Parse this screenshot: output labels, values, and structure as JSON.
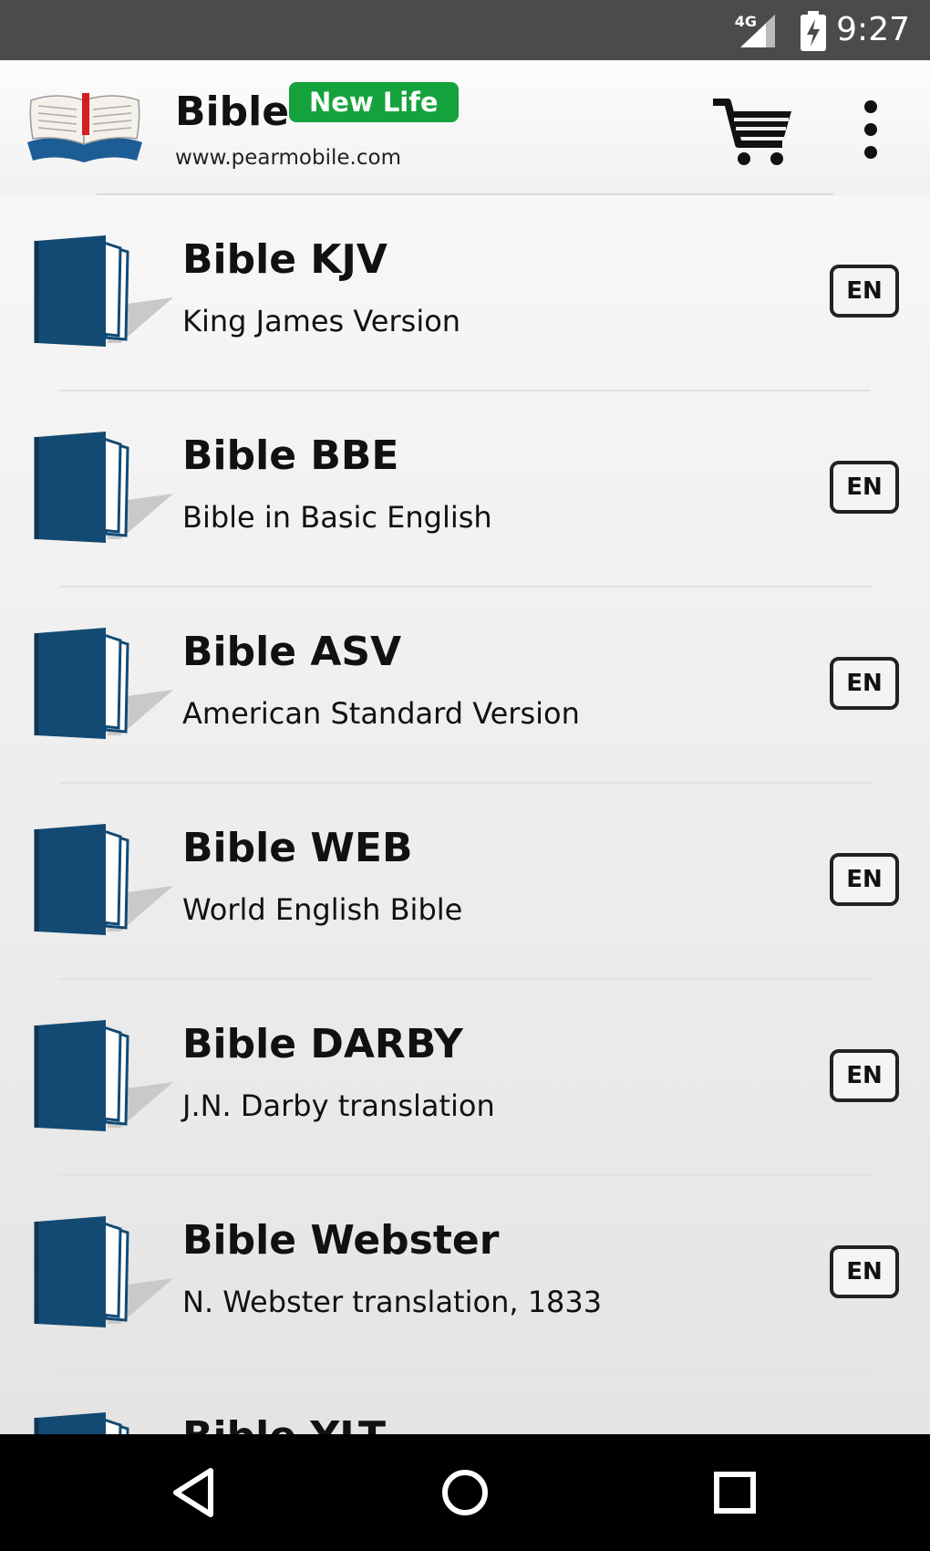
{
  "status_bar": {
    "time": "9:27",
    "network": "4G"
  },
  "app_bar": {
    "title": "Bible",
    "badge": "New Life",
    "url": "www.pearmobile.com",
    "badge_color": "#14a23c"
  },
  "bibles": [
    {
      "title": "Bible KJV",
      "subtitle": "King James Version",
      "lang": "EN"
    },
    {
      "title": "Bible BBE",
      "subtitle": "Bible in Basic English",
      "lang": "EN"
    },
    {
      "title": "Bible ASV",
      "subtitle": "American Standard Version",
      "lang": "EN"
    },
    {
      "title": "Bible WEB",
      "subtitle": "World English Bible",
      "lang": "EN"
    },
    {
      "title": "Bible DARBY",
      "subtitle": "J.N. Darby translation",
      "lang": "EN"
    },
    {
      "title": "Bible Webster",
      "subtitle": "N. Webster translation, 1833",
      "lang": "EN"
    },
    {
      "title": "Bible YLT",
      "subtitle": "",
      "lang": ""
    }
  ],
  "colors": {
    "book_cover": "#134a73",
    "status_bar": "#4b4b4b",
    "nav_bar": "#000000"
  },
  "icons": [
    "signal-icon",
    "battery-charging-icon",
    "bible-logo-icon",
    "cart-icon",
    "overflow-menu-icon",
    "book-icon",
    "back-icon",
    "home-icon",
    "recents-icon"
  ]
}
